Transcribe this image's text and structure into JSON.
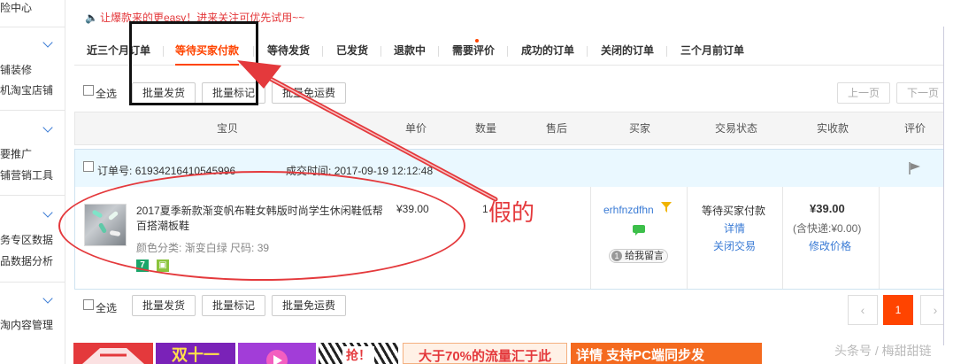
{
  "sidebar": {
    "items": [
      {
        "label": "险中心"
      },
      {
        "label": "铺装修"
      },
      {
        "label": "机淘宝店铺"
      },
      {
        "label": "要推广"
      },
      {
        "label": "铺营销工具"
      },
      {
        "label": "务专区数据"
      },
      {
        "label": "品数据分析"
      },
      {
        "label": "淘内容管理"
      }
    ]
  },
  "notice": {
    "text": "让爆款来的更easy！进来关注可优先试用~~"
  },
  "tabs": [
    {
      "label": "近三个月订单"
    },
    {
      "label": "等待买家付款"
    },
    {
      "label": "等待发货"
    },
    {
      "label": "已发货"
    },
    {
      "label": "退款中"
    },
    {
      "label": "需要评价"
    },
    {
      "label": "成功的订单"
    },
    {
      "label": "关闭的订单"
    },
    {
      "label": "三个月前订单"
    }
  ],
  "toolbar": {
    "select_all": "全选",
    "batch_ship": "批量发货",
    "batch_mark": "批量标记",
    "batch_free_shipping": "批量免运费",
    "prev_page": "上一页",
    "next_page": "下一页"
  },
  "table_headers": [
    "宝贝",
    "单价",
    "数量",
    "售后",
    "买家",
    "交易状态",
    "实收款",
    "评价"
  ],
  "order": {
    "order_no_label": "订单号:",
    "order_no": "61934216410545996",
    "time_label": "成交时间:",
    "time": "2017-09-19 12:12:48",
    "title": "2017夏季新款渐变帆布鞋女韩版时尚学生休闲鞋低帮百搭潮板鞋",
    "spec_color_label": "颜色分类:",
    "spec_color": "渐变白绿",
    "spec_size_label": "尺码:",
    "spec_size": "39",
    "unit_price": "¥39.00",
    "quantity": "1",
    "buyer": "erhfnzdfhn",
    "leave_message": "给我留言",
    "status": "等待买家付款",
    "details": "详情",
    "close_trade": "关闭交易",
    "total": "¥39.00",
    "shipping_note": "(含快递:¥0.00)",
    "modify_price": "修改价格"
  },
  "bottom_toolbar": {
    "select_all": "全选",
    "batch_ship": "批量发货",
    "batch_mark": "批量标记",
    "batch_free_shipping": "批量免运费"
  },
  "pagination": {
    "prev": "‹",
    "current": "1",
    "next": "›"
  },
  "banners": [
    {
      "text": "",
      "color": "#e4393c"
    },
    {
      "text": "双十一",
      "color": "#8b2fc9"
    },
    {
      "text": "",
      "color": "#a23dd8"
    },
    {
      "text": "抢！",
      "color": "#ffffff"
    },
    {
      "text": "大于70%的流量汇于此",
      "color": "#fff1e6"
    },
    {
      "text": "详情 支持PC端同步发",
      "color": "#f46a1f"
    }
  ],
  "watermark": "头条号 / 梅甜甜链",
  "annotation": {
    "label": "假的"
  },
  "colors": {
    "accent": "#ff4400",
    "link": "#3a7bd5",
    "annotation": "#e4393c"
  }
}
